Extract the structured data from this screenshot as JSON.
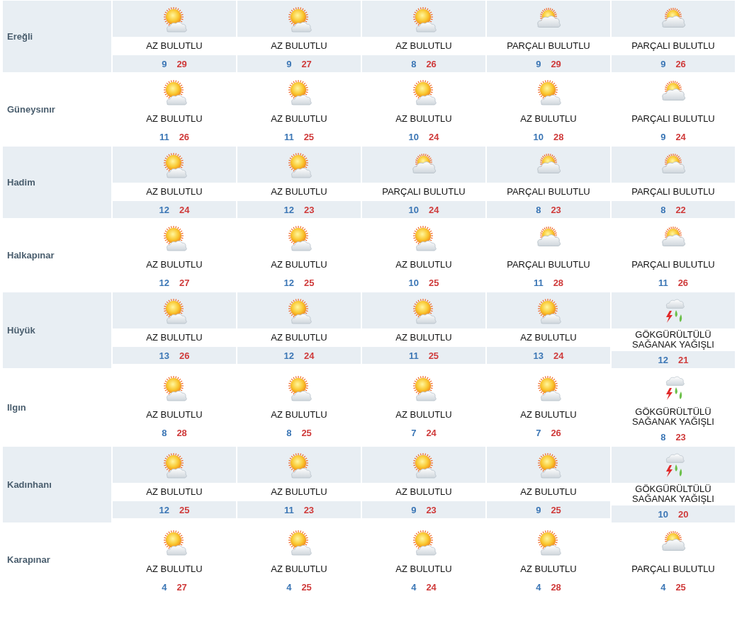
{
  "rows": [
    {
      "name": "Ereğli",
      "days": [
        {
          "kind": "sun-cloud",
          "condition": "AZ BULUTLU",
          "low": "9",
          "high": "29"
        },
        {
          "kind": "sun-cloud",
          "condition": "AZ BULUTLU",
          "low": "9",
          "high": "27"
        },
        {
          "kind": "sun-cloud",
          "condition": "AZ BULUTLU",
          "low": "8",
          "high": "26"
        },
        {
          "kind": "cloud-sun",
          "condition": "PARÇALI BULUTLU",
          "low": "9",
          "high": "29"
        },
        {
          "kind": "cloud-sun",
          "condition": "PARÇALI BULUTLU",
          "low": "9",
          "high": "26"
        }
      ]
    },
    {
      "name": "Güneysınır",
      "days": [
        {
          "kind": "sun-cloud",
          "condition": "AZ BULUTLU",
          "low": "11",
          "high": "26"
        },
        {
          "kind": "sun-cloud",
          "condition": "AZ BULUTLU",
          "low": "11",
          "high": "25"
        },
        {
          "kind": "sun-cloud",
          "condition": "AZ BULUTLU",
          "low": "10",
          "high": "24"
        },
        {
          "kind": "sun-cloud",
          "condition": "AZ BULUTLU",
          "low": "10",
          "high": "28"
        },
        {
          "kind": "cloud-sun",
          "condition": "PARÇALI BULUTLU",
          "low": "9",
          "high": "24"
        }
      ]
    },
    {
      "name": "Hadim",
      "days": [
        {
          "kind": "sun-cloud",
          "condition": "AZ BULUTLU",
          "low": "12",
          "high": "24"
        },
        {
          "kind": "sun-cloud",
          "condition": "AZ BULUTLU",
          "low": "12",
          "high": "23"
        },
        {
          "kind": "cloud-sun",
          "condition": "PARÇALI BULUTLU",
          "low": "10",
          "high": "24"
        },
        {
          "kind": "cloud-sun",
          "condition": "PARÇALI BULUTLU",
          "low": "8",
          "high": "23"
        },
        {
          "kind": "cloud-sun",
          "condition": "PARÇALI BULUTLU",
          "low": "8",
          "high": "22"
        }
      ]
    },
    {
      "name": "Halkapınar",
      "days": [
        {
          "kind": "sun-cloud",
          "condition": "AZ BULUTLU",
          "low": "12",
          "high": "27"
        },
        {
          "kind": "sun-cloud",
          "condition": "AZ BULUTLU",
          "low": "12",
          "high": "25"
        },
        {
          "kind": "sun-cloud",
          "condition": "AZ BULUTLU",
          "low": "10",
          "high": "25"
        },
        {
          "kind": "cloud-sun",
          "condition": "PARÇALI BULUTLU",
          "low": "11",
          "high": "28"
        },
        {
          "kind": "cloud-sun",
          "condition": "PARÇALI BULUTLU",
          "low": "11",
          "high": "26"
        }
      ]
    },
    {
      "name": "Hüyük",
      "days": [
        {
          "kind": "sun-cloud",
          "condition": "AZ BULUTLU",
          "low": "13",
          "high": "26"
        },
        {
          "kind": "sun-cloud",
          "condition": "AZ BULUTLU",
          "low": "12",
          "high": "24"
        },
        {
          "kind": "sun-cloud",
          "condition": "AZ BULUTLU",
          "low": "11",
          "high": "25"
        },
        {
          "kind": "sun-cloud",
          "condition": "AZ BULUTLU",
          "low": "13",
          "high": "24"
        },
        {
          "kind": "storm",
          "condition": "GÖKGÜRÜLTÜLÜ SAĞANAK YAĞIŞLI",
          "low": "12",
          "high": "21"
        }
      ]
    },
    {
      "name": "Ilgın",
      "days": [
        {
          "kind": "sun-cloud",
          "condition": "AZ BULUTLU",
          "low": "8",
          "high": "28"
        },
        {
          "kind": "sun-cloud",
          "condition": "AZ BULUTLU",
          "low": "8",
          "high": "25"
        },
        {
          "kind": "sun-cloud",
          "condition": "AZ BULUTLU",
          "low": "7",
          "high": "24"
        },
        {
          "kind": "sun-cloud",
          "condition": "AZ BULUTLU",
          "low": "7",
          "high": "26"
        },
        {
          "kind": "storm",
          "condition": "GÖKGÜRÜLTÜLÜ SAĞANAK YAĞIŞLI",
          "low": "8",
          "high": "23"
        }
      ]
    },
    {
      "name": "Kadınhanı",
      "days": [
        {
          "kind": "sun-cloud",
          "condition": "AZ BULUTLU",
          "low": "12",
          "high": "25"
        },
        {
          "kind": "sun-cloud",
          "condition": "AZ BULUTLU",
          "low": "11",
          "high": "23"
        },
        {
          "kind": "sun-cloud",
          "condition": "AZ BULUTLU",
          "low": "9",
          "high": "23"
        },
        {
          "kind": "sun-cloud",
          "condition": "AZ BULUTLU",
          "low": "9",
          "high": "25"
        },
        {
          "kind": "storm",
          "condition": "GÖKGÜRÜLTÜLÜ SAĞANAK YAĞIŞLI",
          "low": "10",
          "high": "20"
        }
      ]
    },
    {
      "name": "Karapınar",
      "days": [
        {
          "kind": "sun-cloud",
          "condition": "AZ BULUTLU",
          "low": "4",
          "high": "27"
        },
        {
          "kind": "sun-cloud",
          "condition": "AZ BULUTLU",
          "low": "4",
          "high": "25"
        },
        {
          "kind": "sun-cloud",
          "condition": "AZ BULUTLU",
          "low": "4",
          "high": "24"
        },
        {
          "kind": "sun-cloud",
          "condition": "AZ BULUTLU",
          "low": "4",
          "high": "28"
        },
        {
          "kind": "cloud-sun",
          "condition": "PARÇALI BULUTLU",
          "low": "4",
          "high": "25"
        }
      ]
    }
  ]
}
